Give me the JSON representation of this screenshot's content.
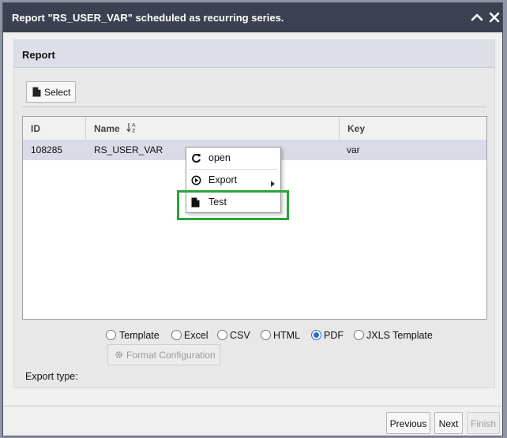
{
  "dialog": {
    "title": "Report \"RS_USER_VAR\" scheduled as recurring series.",
    "collapse_icon": "chevron-up-icon",
    "close_icon": "close-icon"
  },
  "report_panel": {
    "title": "Report",
    "select_button": {
      "label": "Select",
      "icon": "document-icon"
    }
  },
  "grid": {
    "columns": [
      {
        "label": "ID"
      },
      {
        "label": "Name",
        "sort_icon": "sort-alpha-icon"
      },
      {
        "label": "Key"
      }
    ],
    "rows": [
      {
        "id": "108285",
        "name": "RS_USER_VAR",
        "key": "var"
      }
    ]
  },
  "context_menu": {
    "items": [
      {
        "label": "open",
        "icon": "refresh-icon"
      },
      {
        "label": "Export",
        "icon": "play-circle-icon",
        "submenu": true
      },
      {
        "label": "Test",
        "icon": "document-icon"
      }
    ],
    "highlight_color": "#2aa53b"
  },
  "export": {
    "label": "Export type:",
    "options": [
      {
        "label": "Template",
        "selected": false
      },
      {
        "label": "Excel",
        "selected": false
      },
      {
        "label": "CSV",
        "selected": false
      },
      {
        "label": "HTML",
        "selected": false
      },
      {
        "label": "PDF",
        "selected": true
      },
      {
        "label": "JXLS Template",
        "selected": false
      }
    ],
    "format_button": {
      "label": "Format Configuration",
      "icon": "gear-icon",
      "disabled": true
    }
  },
  "footer": {
    "previous": "Previous",
    "next": "Next",
    "finish": "Finish"
  },
  "colors": {
    "titlebar": "#3b4151",
    "panel_header": "#dcdfe8",
    "selected_row": "#d9dce6",
    "radio_accent": "#2a6ac8"
  }
}
